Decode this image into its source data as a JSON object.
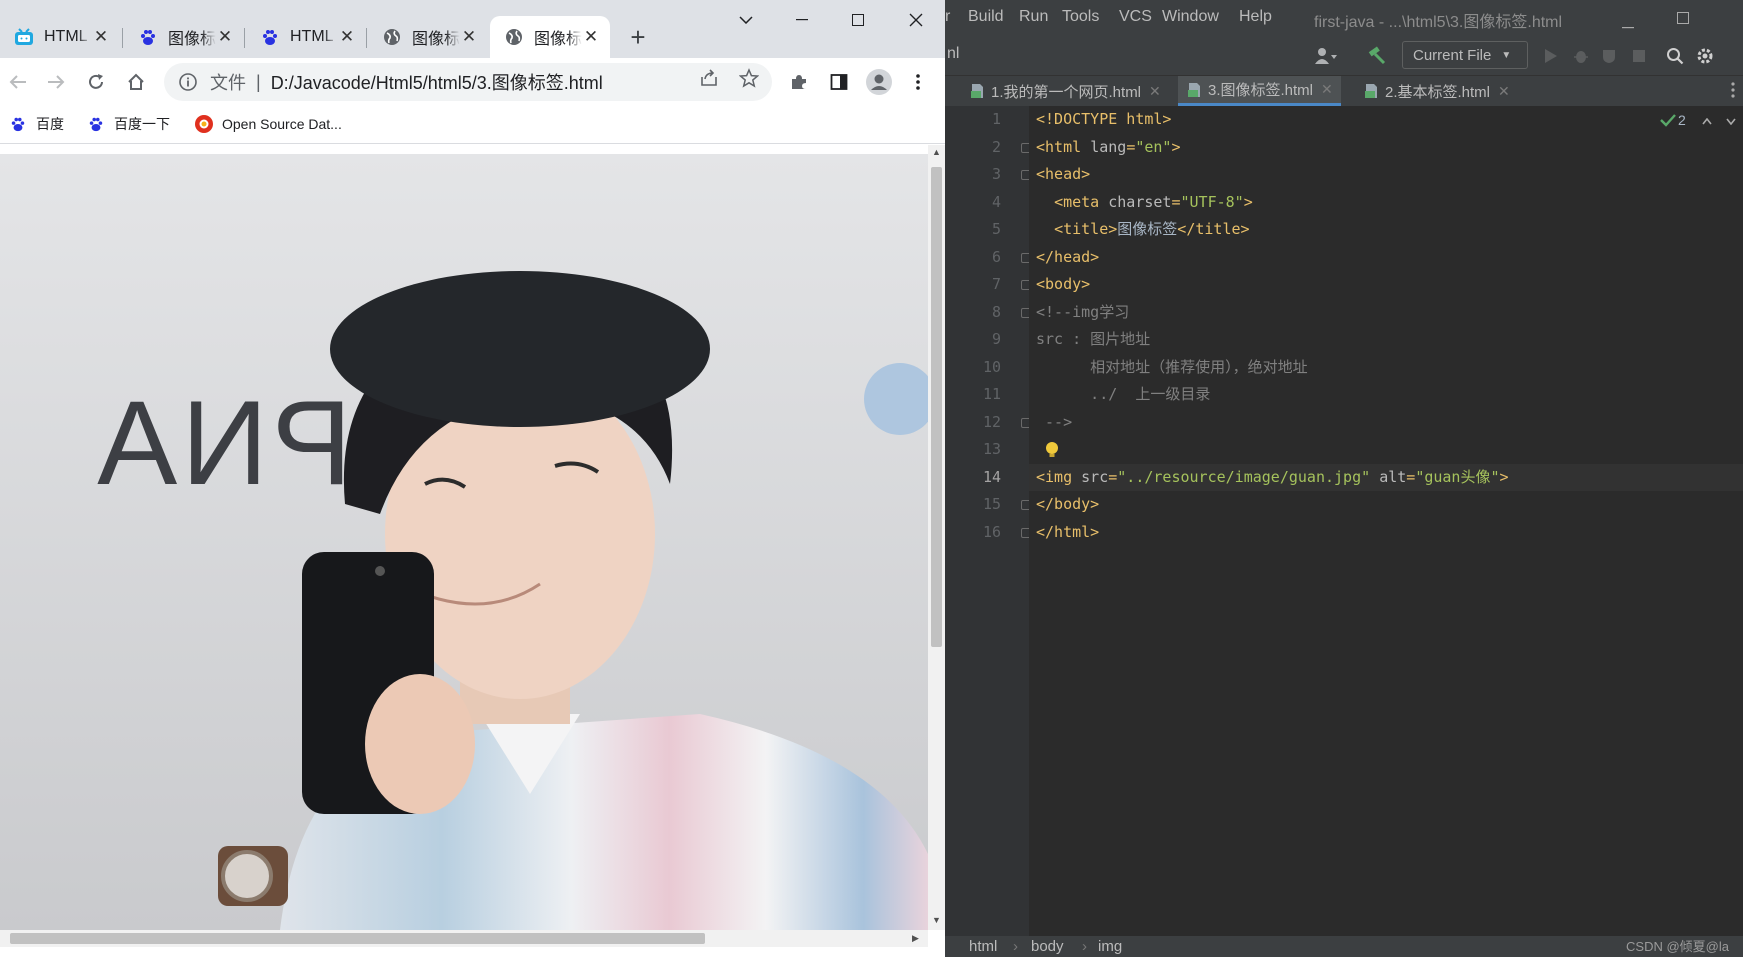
{
  "browser": {
    "tabs": [
      {
        "label": "HTML",
        "icon": "bilibili-icon"
      },
      {
        "label": "图像标",
        "icon": "baidu-paw-icon"
      },
      {
        "label": "HTML",
        "icon": "baidu-paw-icon"
      },
      {
        "label": "图像标",
        "icon": "globe-icon"
      },
      {
        "label": "图像标",
        "icon": "globe-icon",
        "active": true
      }
    ],
    "address": {
      "scheme": "文件",
      "divider": "|",
      "url": "D:/Javacode/Html5/html5/3.图像标签.html"
    },
    "bookmarks": [
      {
        "label": "百度",
        "icon": "baidu-paw-icon"
      },
      {
        "label": "百度一下",
        "icon": "baidu-paw-icon"
      },
      {
        "label": "Open Source Dat...",
        "icon": "red-circle-icon"
      }
    ],
    "page_image_alt": "guan头像",
    "colors": {
      "tabstrip": "#dee1e6",
      "accent": "#1a73e8"
    }
  },
  "ide": {
    "menu": [
      "Build",
      "Run",
      "Tools",
      "VCS",
      "Window",
      "Help"
    ],
    "window_title": "first-java - ...\\html5\\3.图像标签.html",
    "partial_left": "r",
    "partial_toolbar": "nl",
    "run_config": "Current File",
    "editor_tabs": [
      {
        "label": "1.我的第一个网页.html"
      },
      {
        "label": "3.图像标签.html",
        "active": true
      },
      {
        "label": "2.基本标签.html"
      }
    ],
    "inspections": "2",
    "current_line": 14,
    "lines": [
      {
        "n": "1",
        "parts": [
          [
            "tag",
            "<!DOCTYPE html>"
          ]
        ]
      },
      {
        "n": "2",
        "parts": [
          [
            "tag",
            "<html "
          ],
          [
            "attr",
            "lang"
          ],
          [
            "tag",
            "="
          ],
          [
            "val",
            "\"en\""
          ],
          [
            "tag",
            ">"
          ]
        ]
      },
      {
        "n": "3",
        "parts": [
          [
            "tag",
            "<head>"
          ]
        ]
      },
      {
        "n": "4",
        "parts": [
          [
            "plain",
            "  "
          ],
          [
            "tag",
            "<meta "
          ],
          [
            "attr",
            "charset"
          ],
          [
            "tag",
            "="
          ],
          [
            "val",
            "\"UTF-8\""
          ],
          [
            "tag",
            ">"
          ]
        ]
      },
      {
        "n": "5",
        "parts": [
          [
            "plain",
            "  "
          ],
          [
            "tag",
            "<title>"
          ],
          [
            "cjk",
            "图像标签"
          ],
          [
            "tag",
            "</title>"
          ]
        ]
      },
      {
        "n": "6",
        "parts": [
          [
            "tag",
            "</head>"
          ]
        ]
      },
      {
        "n": "7",
        "parts": [
          [
            "tag",
            "<body>"
          ]
        ]
      },
      {
        "n": "8",
        "parts": [
          [
            "cm",
            "<!--img学习"
          ]
        ]
      },
      {
        "n": "9",
        "parts": [
          [
            "cm",
            "src : 图片地址"
          ]
        ]
      },
      {
        "n": "10",
        "parts": [
          [
            "cm",
            "      相对地址（推荐使用），绝对地址"
          ]
        ]
      },
      {
        "n": "11",
        "parts": [
          [
            "cm",
            "      ../  上一级目录"
          ]
        ]
      },
      {
        "n": "12",
        "parts": [
          [
            "cm",
            " -->"
          ]
        ]
      },
      {
        "n": "13",
        "parts": []
      },
      {
        "n": "14",
        "parts": [
          [
            "tag",
            "<img "
          ],
          [
            "attr",
            "src"
          ],
          [
            "tag",
            "="
          ],
          [
            "val",
            "\"../resource/image/guan.jpg\""
          ],
          [
            "plain",
            " "
          ],
          [
            "attr",
            "alt"
          ],
          [
            "tag",
            "="
          ],
          [
            "val",
            "\"guan头像\""
          ],
          [
            "tag",
            ">"
          ]
        ]
      },
      {
        "n": "15",
        "parts": [
          [
            "tag",
            "</body>"
          ]
        ]
      },
      {
        "n": "16",
        "parts": [
          [
            "tag",
            "</html>"
          ]
        ]
      }
    ],
    "breadcrumb": [
      "html",
      "body",
      "img"
    ],
    "watermark": "CSDN @倾夏@la",
    "colors": {
      "background": "#2b2b2b",
      "tag": "#e8bf6a",
      "value": "#a5c25c",
      "comment": "#808080"
    }
  }
}
